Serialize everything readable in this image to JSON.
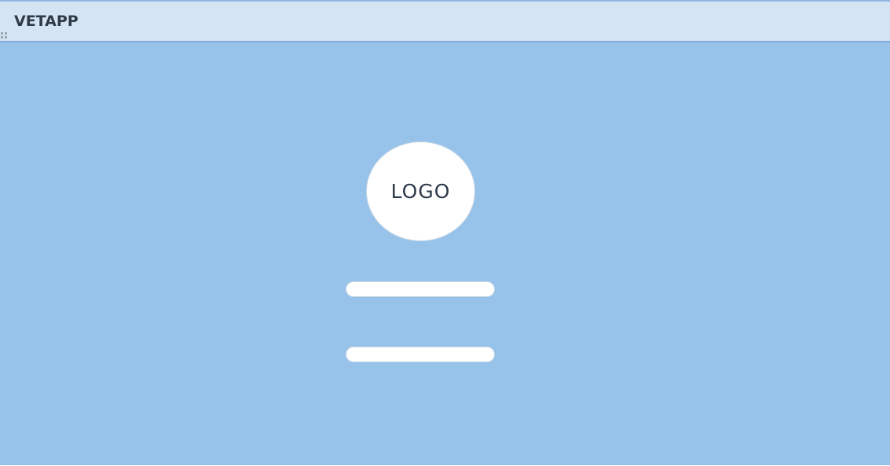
{
  "app": {
    "title": "VETAPP"
  },
  "login": {
    "logo_text": "LOGO",
    "field_1": {
      "value": "",
      "placeholder": ""
    },
    "field_2": {
      "value": "",
      "placeholder": ""
    }
  },
  "colors": {
    "titlebar_bg": "#d5e4f3",
    "content_bg": "#97c3eb",
    "field_bg": "#ffffff",
    "text": "#2e3a48"
  },
  "icons": {
    "titlebar_grip": "drag-grip-icon"
  }
}
